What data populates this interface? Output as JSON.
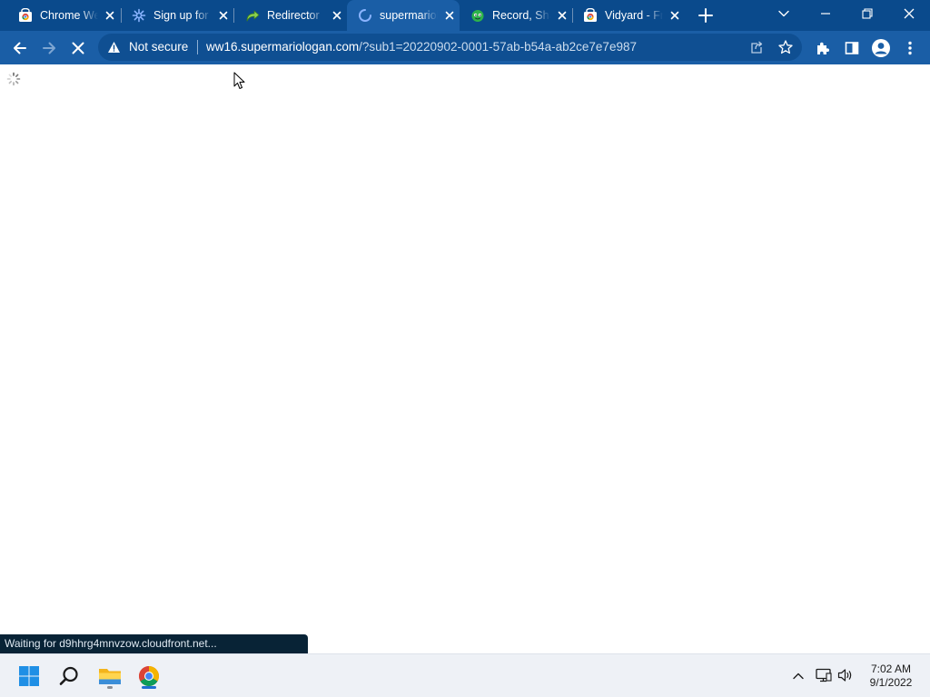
{
  "browser": {
    "tabs": [
      {
        "title": "Chrome Web Store",
        "icon": "chrome-web-store-icon",
        "active": false
      },
      {
        "title": "Sign up for",
        "icon": "sign-up-favicon-icon",
        "active": false
      },
      {
        "title": "Redirector",
        "icon": "redirector-arrow-icon",
        "active": false
      },
      {
        "title": "supermariologan",
        "icon": "loading-spinner-icon",
        "active": true
      },
      {
        "title": "Record, Share",
        "icon": "record-favicon-icon",
        "active": false
      },
      {
        "title": "Vidyard - Free",
        "icon": "vidyard-favicon-icon",
        "active": false
      }
    ],
    "omnibox": {
      "security_label": "Not secure",
      "url_host": "ww16.supermariologan.com",
      "url_path": "/?sub1=20220902-0001-57ab-b54a-ab2ce7e7e987"
    },
    "status_bubble": "Waiting for d9hhrg4mnvzow.cloudfront.net..."
  },
  "taskbar": {
    "apps": [
      "windows-start-icon",
      "search-icon",
      "file-explorer-icon",
      "chrome-icon"
    ],
    "time": "7:02 AM",
    "date": "9/1/2022"
  },
  "colors": {
    "tabstrip": "#0a4a8c",
    "toolbar": "#1a5ea6",
    "omnibox": "#0f4f92",
    "status_bubble": "#082336",
    "taskbar": "#eef1f6"
  }
}
